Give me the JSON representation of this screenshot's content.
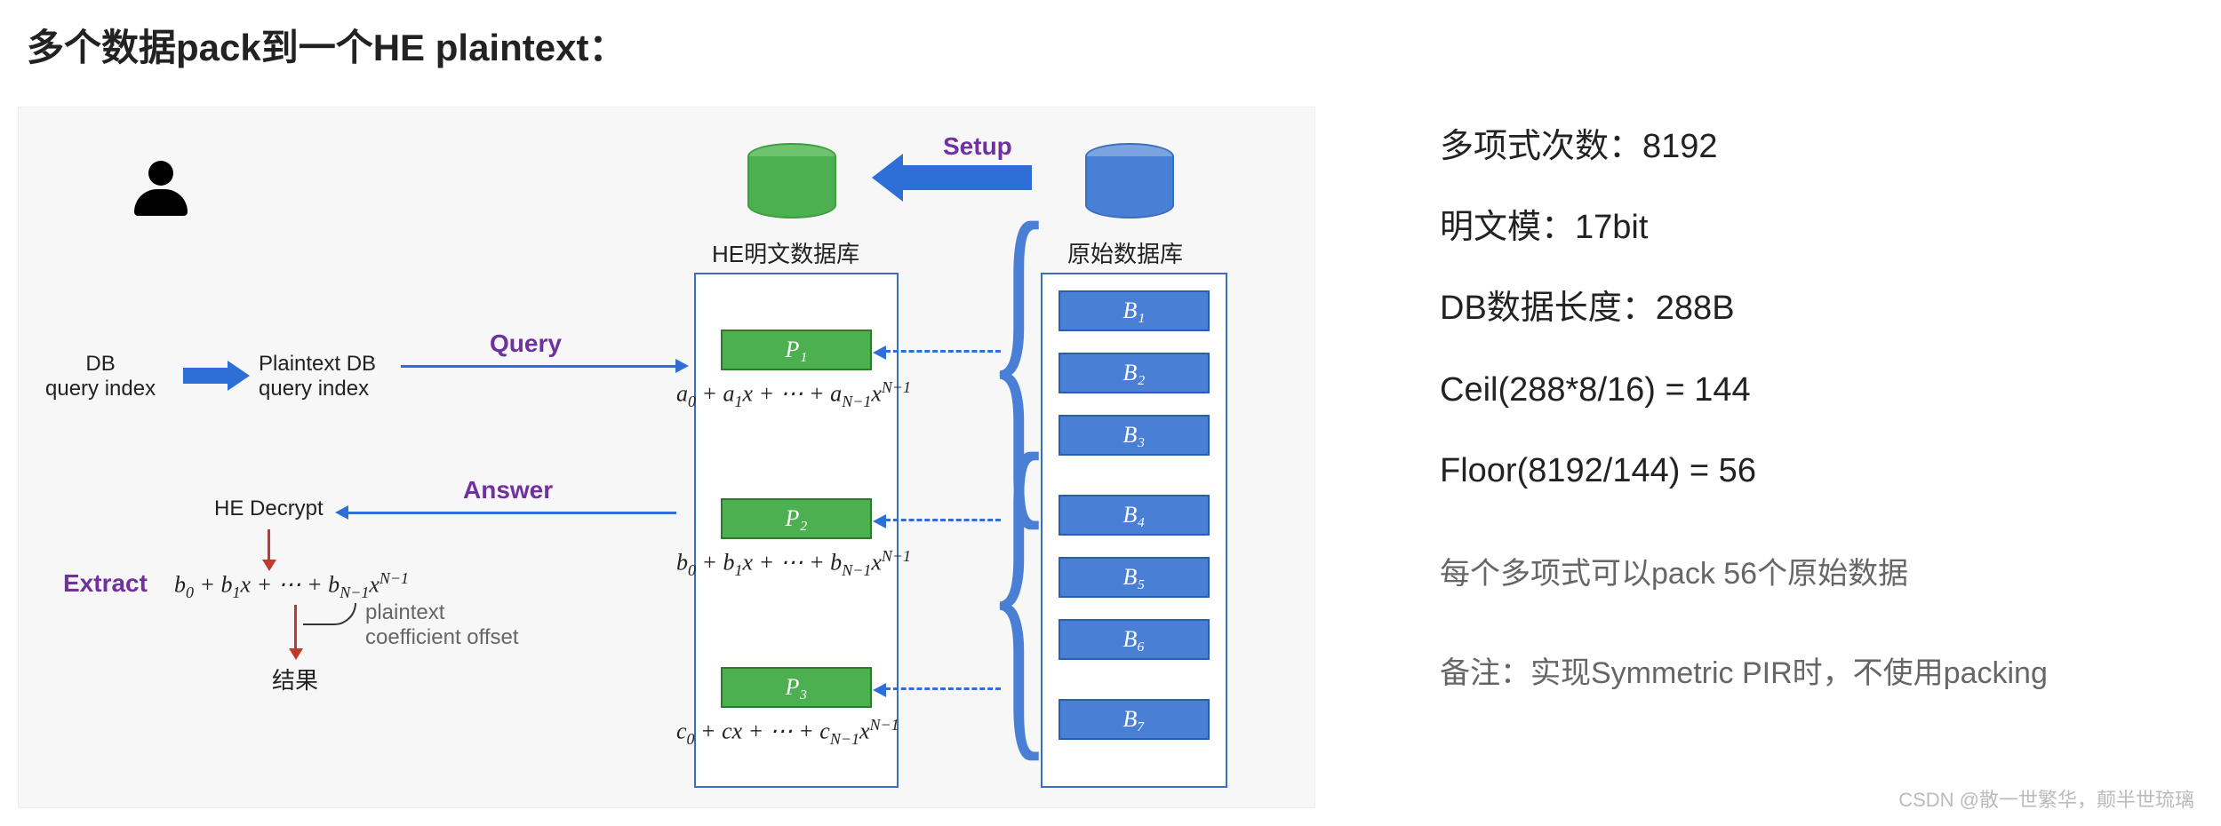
{
  "title": "多个数据pack到一个HE plaintext：",
  "diagram": {
    "setup_label": "Setup",
    "he_db_label": "HE明文数据库",
    "raw_db_label": "原始数据库",
    "client_db_label_1": "DB",
    "client_db_label_2": "query index",
    "plaintext_db_label_1": "Plaintext DB",
    "plaintext_db_label_2": "query index",
    "query_label": "Query",
    "answer_label": "Answer",
    "he_decrypt_label": "HE Decrypt",
    "extract_label": "Extract",
    "coeff_label_1": "plaintext",
    "coeff_label_2": "coefficient offset",
    "result_label": "结果",
    "p_boxes": [
      "P₁",
      "P₂",
      "P₃"
    ],
    "b_boxes": [
      "B₁",
      "B₂",
      "B₃",
      "B₄",
      "B₅",
      "B₆",
      "B₇"
    ],
    "formula_a": "a₀ + a₁x + ⋯ + a_{N−1}x^{N−1}",
    "formula_b": "b₀ + b₁x + ⋯ + b_{N−1}x^{N−1}",
    "formula_c": "c₀ + cx + ⋯ + c_{N−1}x^{N−1}",
    "formula_extract": "b₀ + b₁x + ⋯ + b_{N−1}x^{N−1}"
  },
  "notes": {
    "line1": "多项式次数：8192",
    "line2": "明文模：17bit",
    "line3": "DB数据长度：288B",
    "line4": "Ceil(288*8/16) = 144",
    "line5": "Floor(8192/144) = 56",
    "line6": "每个多项式可以pack 56个原始数据",
    "line7": "备注：实现Symmetric PIR时，不使用packing"
  },
  "watermark": "CSDN @散一世繁华，颠半世琉璃"
}
